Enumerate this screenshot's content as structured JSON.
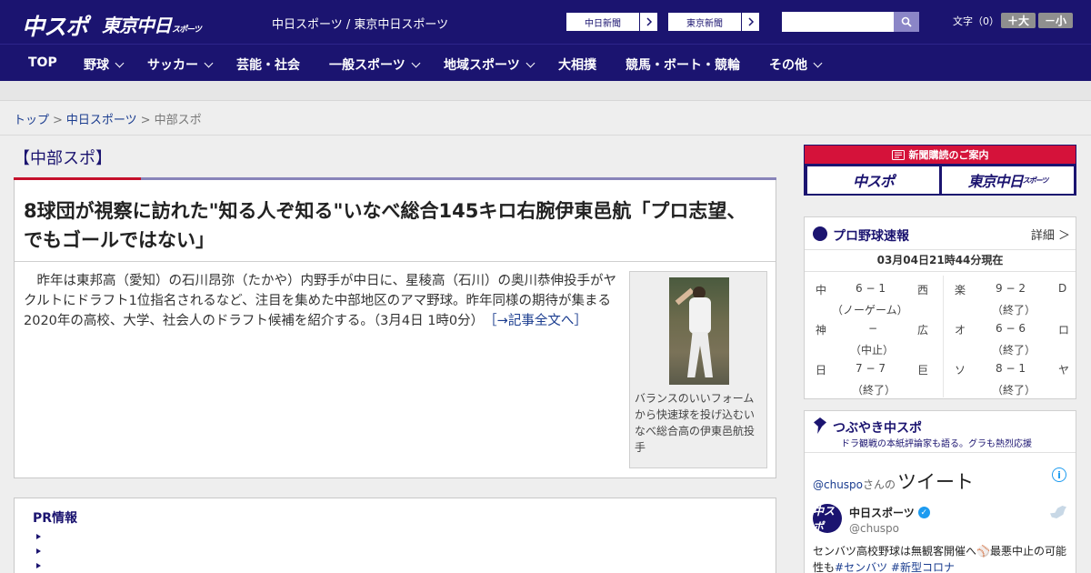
{
  "header": {
    "logo_chuspo": "中スポ",
    "logo_tokyo": "東京中日",
    "logo_tokyo_small": "スポーツ",
    "site_names": "中日スポーツ / 東京中日スポーツ",
    "ext_link_1": "中日新聞",
    "ext_link_2": "東京新聞",
    "search_placeholder": "",
    "font_size_label": "文字（0）",
    "font_larger": "＋大",
    "font_smaller": "－小"
  },
  "nav": {
    "items": [
      {
        "label": "TOP",
        "dropdown": false
      },
      {
        "label": "野球",
        "dropdown": true
      },
      {
        "label": "サッカー",
        "dropdown": true
      },
      {
        "label": "芸能・社会",
        "dropdown": false
      },
      {
        "label": "一般スポーツ",
        "dropdown": true
      },
      {
        "label": "地域スポーツ",
        "dropdown": true
      },
      {
        "label": "大相撲",
        "dropdown": false
      },
      {
        "label": "競馬・ボート・競輪",
        "dropdown": false
      },
      {
        "label": "その他",
        "dropdown": true
      }
    ]
  },
  "breadcrumb": {
    "home": "トップ",
    "sep1": ">",
    "section": "中日スポーツ",
    "sep2": ">",
    "current": "中部スポ"
  },
  "section_title": "【中部スポ】",
  "article": {
    "headline": "8球団が視察に訪れた\"知る人ぞ知る\"いなべ総合145キロ右腕伊東邑航「プロ志望、でもゴールではない」",
    "summary": "昨年は東邦高（愛知）の石川昂弥（たかや）内野手が中日に、星稜高（石川）の奥川恭伸投手がヤクルトにドラフト1位指名されるなど、注目を集めた中部地区のアマ野球。昨年同様の期待が集まる2020年の高校、大学、社会人のドラフト候補を紹介する。（3月4日 1時0分）",
    "read_more": "［→記事全文へ］",
    "photo_caption": "バランスのいいフォームから快速球を投げ込むいなべ総合高の伊東邑航投手"
  },
  "pr": {
    "title": "PR情報"
  },
  "subscribe": {
    "banner": "新聞購読のご案内",
    "btn_chuspo": "中スポ",
    "btn_tokyo": "東京中日",
    "btn_tokyo_small": "スポーツ"
  },
  "baseball": {
    "title": "プロ野球速報",
    "detail": "詳細 ＞",
    "updated": "03月04日21時44分現在",
    "games": [
      {
        "home": "中",
        "score": "6 − 1",
        "away": "西",
        "status": "（ノーゲーム）"
      },
      {
        "home": "楽",
        "score": "9 − 2",
        "away": "D",
        "status": "（終了）"
      },
      {
        "home": "神",
        "score": "−",
        "away": "広",
        "status": "（中止）"
      },
      {
        "home": "オ",
        "score": "6 − 6",
        "away": "ロ",
        "status": "（終了）"
      },
      {
        "home": "日",
        "score": "7 − 7",
        "away": "巨",
        "status": "（終了）"
      },
      {
        "home": "ソ",
        "score": "8 − 1",
        "away": "ヤ",
        "status": "（終了）"
      }
    ]
  },
  "twitter": {
    "title": "つぶやき中スポ",
    "subtitle": "ドラ観戦の本紙評論家も語る。グラも熱烈応援",
    "handle_link": "@chuspo",
    "handle_suffix": "さんの",
    "heading": "ツイート",
    "info_icon": "i",
    "account_name": "中日スポーツ",
    "account_handle": "@chuspo",
    "avatar_text": "中スポ",
    "tweet_text_1": "センバツ高校野球は無観客開催へ",
    "tweet_emoji": "⚾",
    "tweet_text_2": "最悪中止の可能性も",
    "tweet_tag_1": "#センバツ",
    "tweet_tag_2": "#新型コロナ"
  },
  "colors": {
    "brand_navy": "#1b1470",
    "accent_red": "#c5102c",
    "link_blue": "#1a3c8f",
    "twitter_blue": "#1d9bf0"
  }
}
